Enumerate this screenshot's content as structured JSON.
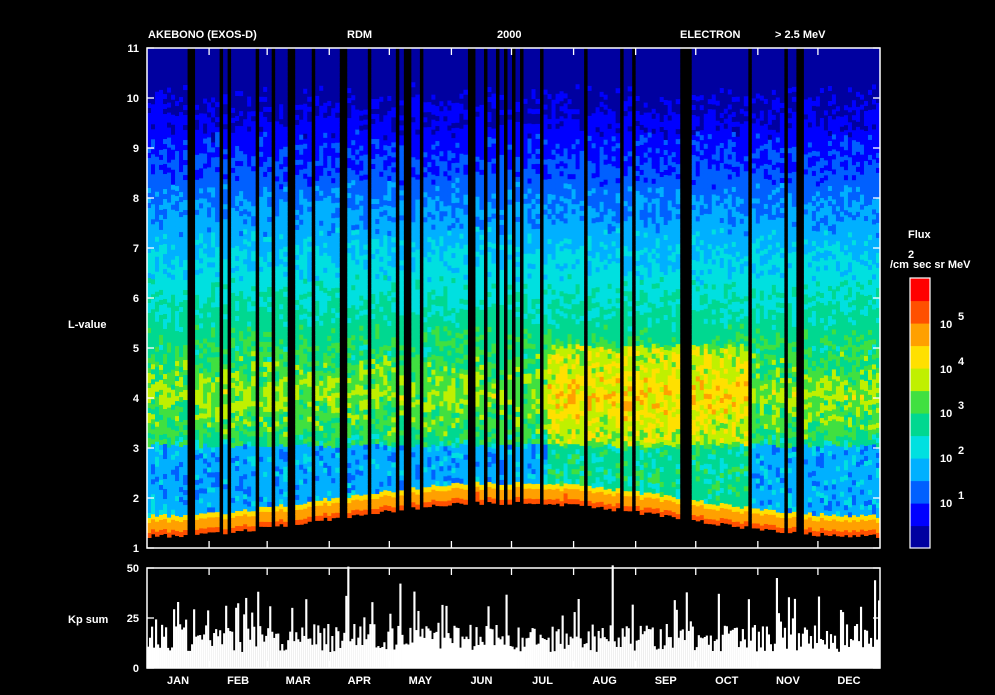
{
  "header": {
    "mission": "AKEBONO (EXOS-D)",
    "instrument": "RDM",
    "year": "2000",
    "particle": "ELECTRON",
    "energy": "> 2.5 MeV"
  },
  "colors": {
    "background": "#000000",
    "axes": "#ffffff",
    "colormap": [
      "#0000a0",
      "#0000ff",
      "#0060ff",
      "#00b0ff",
      "#00e0e0",
      "#00d890",
      "#40e040",
      "#c0f000",
      "#ffe000",
      "#ffa000",
      "#ff5000",
      "#ff0000"
    ]
  },
  "chart_data": [
    {
      "type": "heatmap",
      "ylabel": "L-value",
      "ylim": [
        1,
        11
      ],
      "y_ticks": [
        "1",
        "2",
        "3",
        "4",
        "5",
        "6",
        "7",
        "8",
        "9",
        "10",
        "11"
      ],
      "months": [
        "JAN",
        "FEB",
        "MAR",
        "APR",
        "MAY",
        "JUN",
        "JUL",
        "AUG",
        "SEP",
        "OCT",
        "NOV",
        "DEC"
      ],
      "colorbar": {
        "title": "Flux",
        "units_line": "/cm",
        "units_sup": "2",
        "units_rest": "sec sr MeV",
        "tick_labels": [
          {
            "base": "10",
            "exp": "5"
          },
          {
            "base": "10",
            "exp": "4"
          },
          {
            "base": "10",
            "exp": "3"
          },
          {
            "base": "10",
            "exp": "2"
          },
          {
            "base": "10",
            "exp": "1"
          }
        ]
      }
    },
    {
      "type": "bar",
      "ylabel": "Kp sum",
      "ylim": [
        0,
        50
      ],
      "y_ticks": [
        "0",
        "25",
        "50"
      ],
      "months": [
        "JAN",
        "FEB",
        "MAR",
        "APR",
        "MAY",
        "JUN",
        "JUL",
        "AUG",
        "SEP",
        "OCT",
        "NOV",
        "DEC"
      ]
    }
  ]
}
